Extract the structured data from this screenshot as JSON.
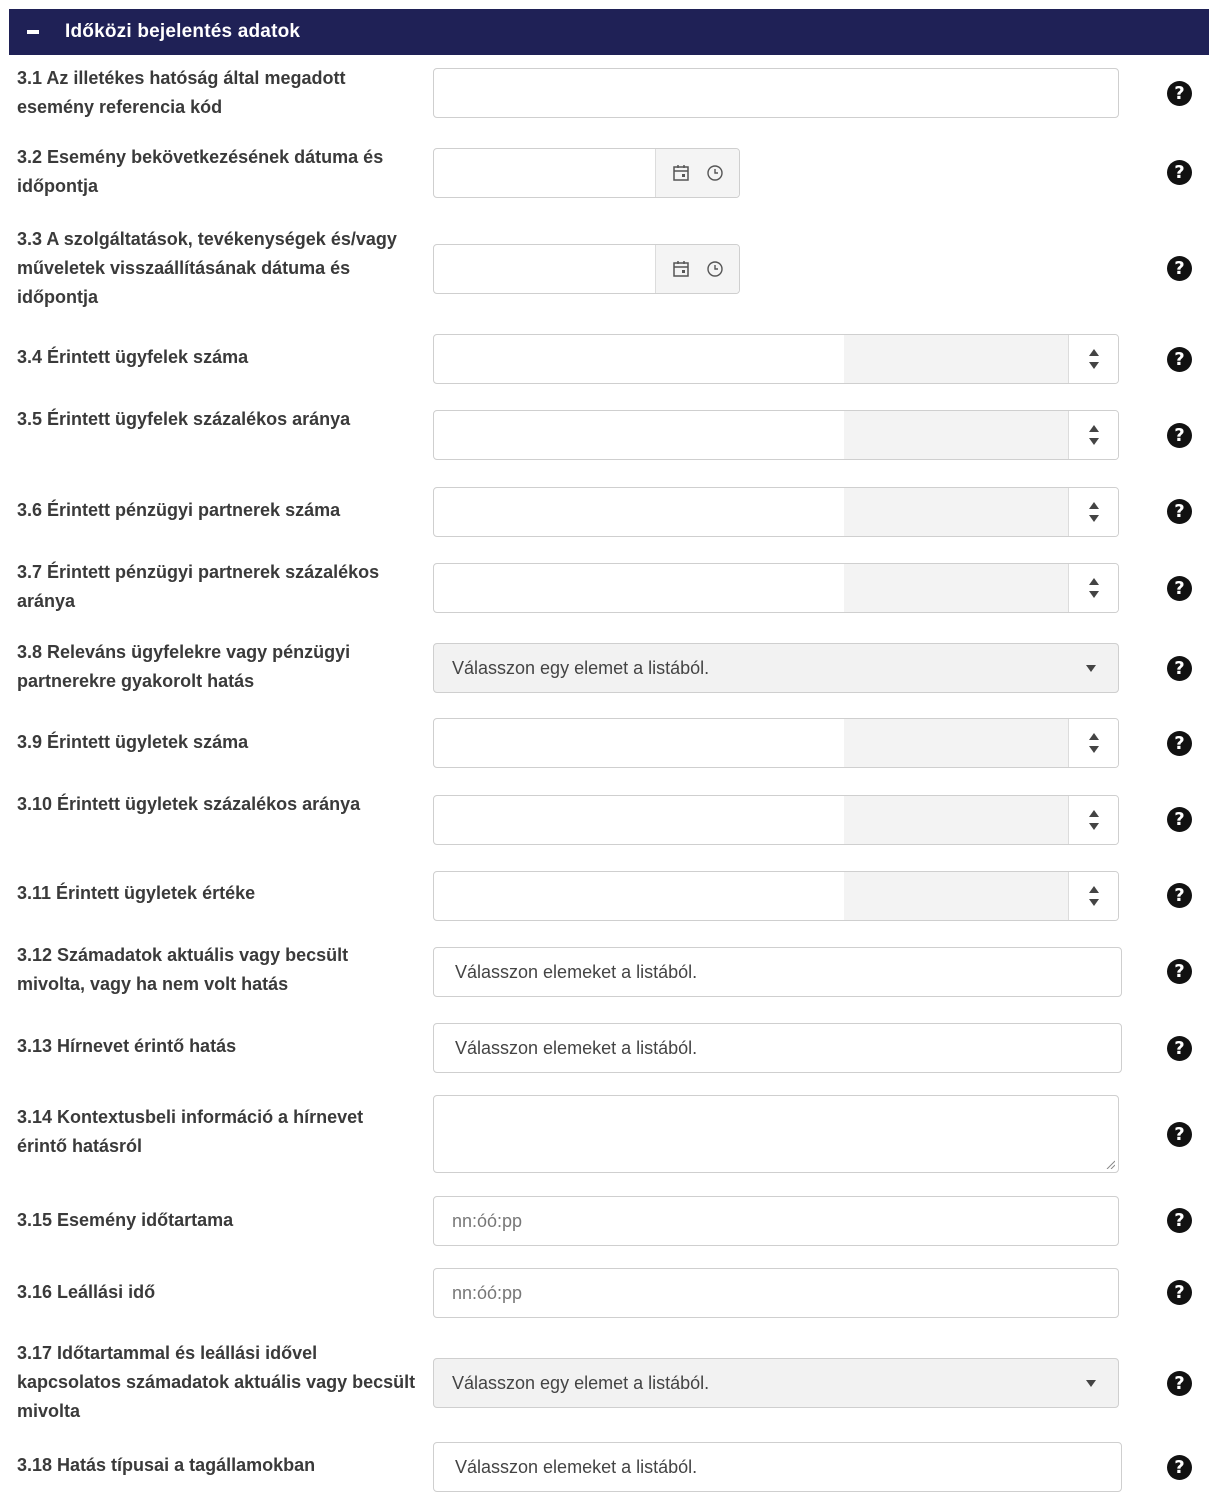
{
  "header": {
    "title": "Időközi bejelentés adatok"
  },
  "fields": {
    "f31": {
      "label": "3.1 Az illetékes hatóság által megadott esemény referencia kód",
      "value": ""
    },
    "f32": {
      "label": "3.2 Esemény bekövetkezésének dátuma és időpontja",
      "value": ""
    },
    "f33": {
      "label": "3.3 A szolgáltatások, tevékenységek és/vagy műveletek visszaállításának dátuma és időpontja",
      "value": ""
    },
    "f34": {
      "label": "3.4 Érintett ügyfelek száma",
      "value": ""
    },
    "f35": {
      "label": "3.5 Érintett ügyfelek százalékos aránya",
      "value": ""
    },
    "f36": {
      "label": "3.6 Érintett pénzügyi partnerek száma",
      "value": ""
    },
    "f37": {
      "label": "3.7 Érintett pénzügyi partnerek százalékos aránya",
      "value": ""
    },
    "f38": {
      "label": "3.8 Releváns ügyfelekre vagy pénzügyi partnerekre gyakorolt hatás",
      "selected": "Válasszon egy elemet a listából."
    },
    "f39": {
      "label": "3.9 Érintett ügyletek száma",
      "value": ""
    },
    "f310": {
      "label": "3.10 Érintett ügyletek százalékos aránya",
      "value": ""
    },
    "f311": {
      "label": "3.11 Érintett ügyletek értéke",
      "value": ""
    },
    "f312": {
      "label": "3.12 Számadatok aktuális vagy becsült mivolta, vagy ha nem volt hatás",
      "placeholder": "Válasszon elemeket a listából."
    },
    "f313": {
      "label": "3.13 Hírnevet érintő hatás",
      "placeholder": "Válasszon elemeket a listából."
    },
    "f314": {
      "label": "3.14 Kontextusbeli információ a hírnevet érintő hatásról",
      "value": ""
    },
    "f315": {
      "label": "3.15 Esemény időtartama",
      "placeholder": "nn:óó:pp"
    },
    "f316": {
      "label": "3.16 Leállási idő",
      "placeholder": "nn:óó:pp"
    },
    "f317": {
      "label": "3.17 Időtartammal és leállási idővel kapcsolatos számadatok aktuális vagy becsült mivolta",
      "selected": "Válasszon egy elemet a listából."
    },
    "f318": {
      "label": "3.18 Hatás típusai a tagállamokban",
      "placeholder": "Válasszon elemeket a listából."
    }
  },
  "icons": {
    "help": "question-circle-icon",
    "calendar": "calendar-icon",
    "clock": "clock-icon",
    "collapse": "minus-icon"
  },
  "colors": {
    "header_bg": "#1f2156",
    "header_text": "#ffffff"
  },
  "help_glyph": "?"
}
